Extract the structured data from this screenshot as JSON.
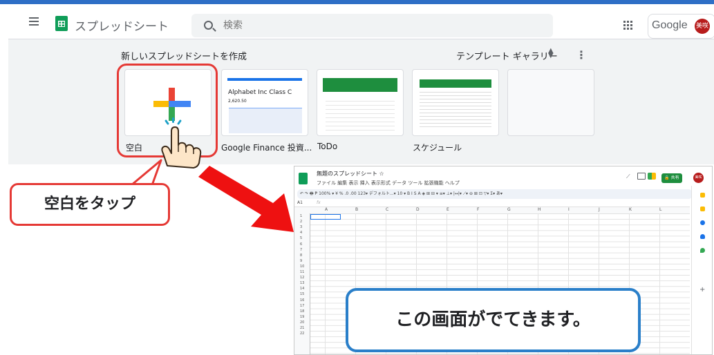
{
  "header": {
    "app_title": "スプレッドシート",
    "search_placeholder": "検索",
    "google_label": "Google",
    "avatar_initials": "美咲"
  },
  "templates": {
    "new_label": "新しいスプレッドシートを作成",
    "gallery_label": "テンプレート ギャラリー",
    "cards": [
      {
        "label": "空白"
      },
      {
        "label": "Google Finance 投資..."
      },
      {
        "label": "ToDo"
      },
      {
        "label": "スケジュール"
      },
      {
        "label": ""
      }
    ],
    "finance_card_title": "Alphabet Inc Class C",
    "finance_card_value": "2,620.50"
  },
  "annotations": {
    "tap_blank": "空白をタップ",
    "screen_appears": "この画面がでてきます。"
  },
  "spreadsheet": {
    "title": "無題のスプレッドシート ☆",
    "menu": "ファイル  編集  表示  挿入  表示形式  データ  ツール  拡張機能  ヘルプ",
    "toolbar": "↶ ↷ 🖶 ₱  100% ▾  ¥  %  .0  .00  123▾  デフォルト...▾  10  ▾  B  I  S  A  ◈  ⊞  ⊟ ▾  ≡▾  ⊥▾  |↔|▾  ⟋▾  ⊖  ⊞  ⊡  ▽▾  Σ▾  あ▾",
    "share_label": "🔒 共有",
    "avatar_initials": "美咲",
    "cell_ref": "A1",
    "fx": "fx",
    "columns": [
      "A",
      "B",
      "C",
      "D",
      "E",
      "F",
      "G",
      "H",
      "I",
      "J",
      "K",
      "L"
    ],
    "rows": [
      "1",
      "2",
      "3",
      "4",
      "5",
      "6",
      "7",
      "8",
      "9",
      "10",
      "11",
      "12",
      "13",
      "14",
      "15",
      "16",
      "17",
      "18",
      "19",
      "20",
      "21",
      "22"
    ]
  },
  "colors": {
    "accent_red": "#e53935",
    "accent_blue": "#2a7fc9",
    "sheets_green": "#0f9d58"
  }
}
